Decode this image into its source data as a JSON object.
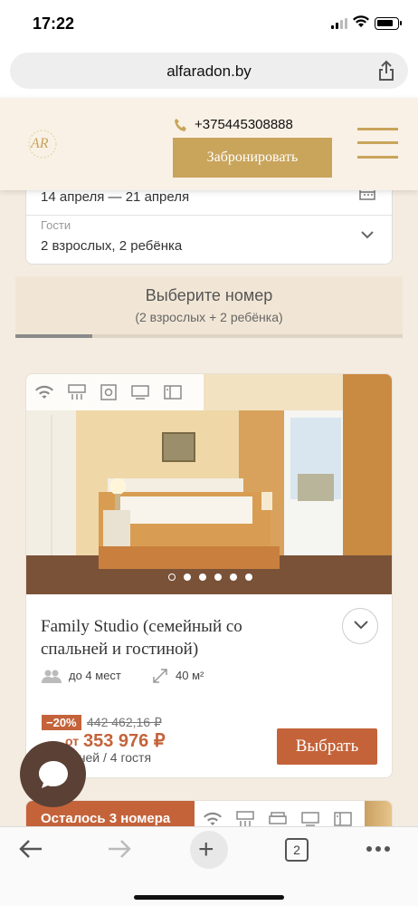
{
  "status": {
    "time": "17:22"
  },
  "browser": {
    "url": "alfaradon.by",
    "tabs_count": "2"
  },
  "header": {
    "logo_text": "AR",
    "phone": "+375445308888",
    "book_label": "Забронировать"
  },
  "booking": {
    "dates": "14 апреля — 21 апреля",
    "guests_label": "Гости",
    "guests_value": "2 взрослых, 2 ребёнка"
  },
  "select": {
    "title": "Выберите номер",
    "subtitle": "(2 взрослых + 2 ребёнка)"
  },
  "room": {
    "name": "Family Studio (семейный со спальней и гостиной)",
    "capacity": "до 4 мест",
    "area": "40 м²",
    "discount": "−20%",
    "old_price": "442 462,16 ₽",
    "price_prefix": "от",
    "price": "353 976 ₽",
    "price_sub": "ночей / 4 гостя",
    "choose_label": "Выбрать",
    "photo_count": 6,
    "active_photo": 1
  },
  "next_room": {
    "badge": "Осталось 3 номера"
  },
  "colors": {
    "gold": "#c9a45b",
    "terracotta": "#c4633a",
    "cream": "#f4ece0"
  }
}
